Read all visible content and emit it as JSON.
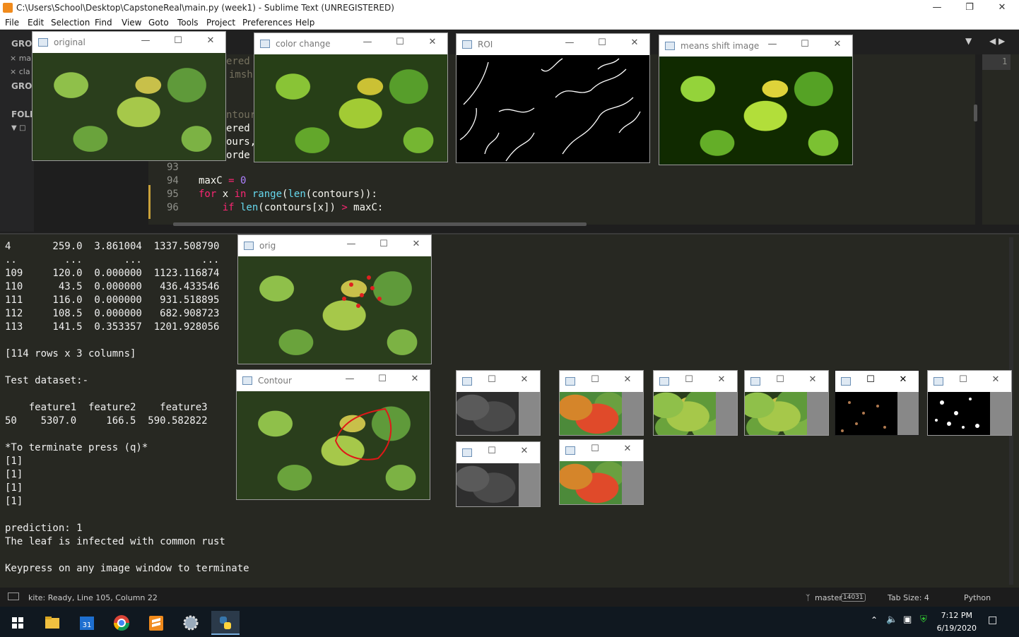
{
  "titlebar": {
    "title": "C:\\Users\\School\\Desktop\\CapstoneReal\\main.py (week1) - Sublime Text (UNREGISTERED)"
  },
  "menu": [
    "File",
    "Edit",
    "Selection",
    "Find",
    "View",
    "Goto",
    "Tools",
    "Project",
    "Preferences",
    "Help"
  ],
  "sidebar": {
    "groups": [
      "GRO",
      "GRO"
    ],
    "files": [
      "ma",
      "cla"
    ],
    "folders": "FOLD"
  },
  "partial_code": [
    "ered",
    "imsh",
    "ntour",
    "ered",
    "ours,",
    "orde"
  ],
  "minimap_line": "1",
  "code_lines": [
    {
      "num": "93",
      "parts": []
    },
    {
      "num": "94",
      "parts": [
        {
          "t": "maxC ",
          "c": "txt"
        },
        {
          "t": "=",
          "c": "kw"
        },
        {
          "t": " 0",
          "c": "num"
        }
      ]
    },
    {
      "num": "95",
      "parts": [
        {
          "t": "for",
          "c": "kw"
        },
        {
          "t": " x ",
          "c": "txt"
        },
        {
          "t": "in",
          "c": "kw"
        },
        {
          "t": " range",
          "c": "fn"
        },
        {
          "t": "(",
          "c": "txt"
        },
        {
          "t": "len",
          "c": "fn"
        },
        {
          "t": "(contours)):",
          "c": "txt"
        }
      ]
    },
    {
      "num": "96",
      "parts": [
        {
          "t": "    if",
          "c": "kw"
        },
        {
          "t": " len",
          "c": "fn"
        },
        {
          "t": "(contours[x]) ",
          "c": "txt"
        },
        {
          "t": ">",
          "c": "kw"
        },
        {
          "t": " maxC:",
          "c": "txt"
        }
      ]
    }
  ],
  "console_lines": [
    "4       259.0  3.861004  1337.508790",
    "..        ...       ...          ...",
    "109     120.0  0.000000  1123.116874",
    "110      43.5  0.000000   436.433546",
    "111     116.0  0.000000   931.518895",
    "112     108.5  0.000000   682.908723",
    "113     141.5  0.353357  1201.928056",
    "",
    "[114 rows x 3 columns]",
    "",
    "Test dataset:-",
    "",
    "    feature1  feature2    feature3",
    "50    5307.0     166.5  590.582822",
    "",
    "*To terminate press (q)*",
    "[1]",
    "[1]",
    "[1]",
    "[1]",
    "",
    "prediction: 1",
    "The leaf is infected with common rust",
    "",
    "Keypress on any image window to terminate"
  ],
  "statusbar": {
    "status": "kite: Ready, Line 105, Column 22",
    "branch": "master",
    "changes": "14031",
    "tabsize": "Tab Size: 4",
    "syntax": "Python"
  },
  "taskbar": {
    "time": "7:12 PM",
    "date": "6/19/2020",
    "calendar_day": "31"
  },
  "windows": {
    "original": "original",
    "color_change": "color change",
    "roi": "ROI",
    "mean_shift": "means shift image",
    "orig": "orig",
    "contour": "Contour"
  }
}
